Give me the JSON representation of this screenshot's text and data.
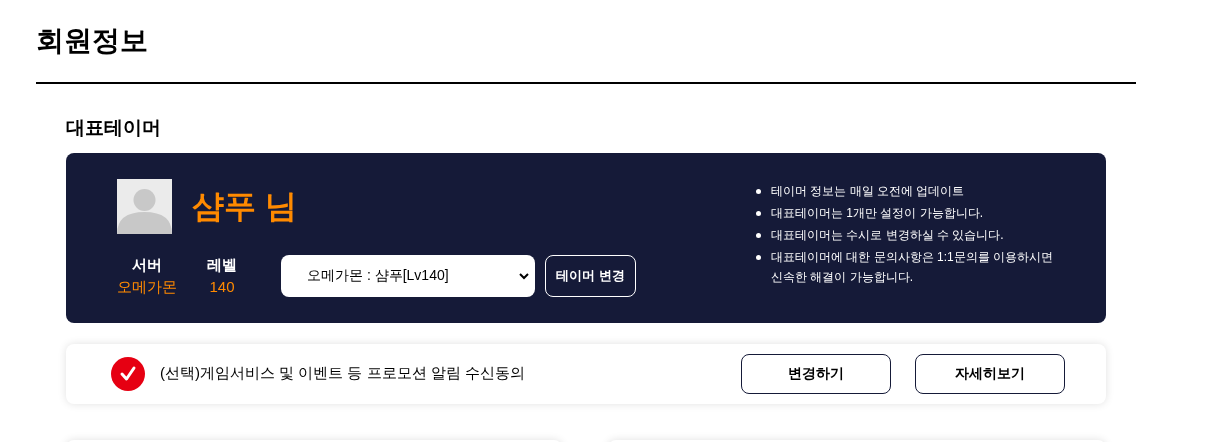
{
  "page_title": "회원정보",
  "section_title": "대표테이머",
  "profile": {
    "name": "샴푸 님",
    "stats": [
      {
        "label": "서버",
        "value": "오메가몬"
      },
      {
        "label": "레벨",
        "value": "140"
      }
    ],
    "select": {
      "value": "오메가몬 : 샴푸[Lv140]"
    },
    "change_button": "테이머 변경",
    "notes": [
      "테이머 정보는 매일 오전에 업데이트",
      "대표테이머는 1개만 설정이 가능합니다.",
      "대표테이머는 수시로 변경하실 수 있습니다.",
      "대표테이머에 대한 문의사항은 1:1문의를 이용하시면 신속한 해결이 가능합니다."
    ]
  },
  "consent": {
    "checked": true,
    "label": "(선택)게임서비스 및 이벤트 등 프로모션 알림 수신동의",
    "buttons": [
      "변경하기",
      "자세히보기"
    ]
  }
}
